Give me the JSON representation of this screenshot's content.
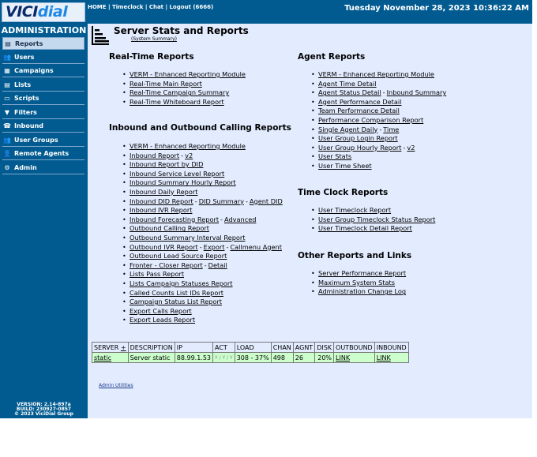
{
  "header": {
    "logo": {
      "vici": "VICI",
      "dial": "dial"
    },
    "links": [
      "HOME",
      "Timeclock",
      "Chat",
      "Logout (6666)"
    ],
    "datetime": "Tuesday November 28, 2023 10:36:22 AM"
  },
  "sidebar": {
    "title": "ADMINISTRATION",
    "items": [
      {
        "label": "Reports",
        "icon": "reports-icon",
        "glyph": "▤"
      },
      {
        "label": "Users",
        "icon": "users-icon",
        "glyph": "👥"
      },
      {
        "label": "Campaigns",
        "icon": "campaigns-icon",
        "glyph": "▦"
      },
      {
        "label": "Lists",
        "icon": "lists-icon",
        "glyph": "▤"
      },
      {
        "label": "Scripts",
        "icon": "scripts-icon",
        "glyph": "▭"
      },
      {
        "label": "Filters",
        "icon": "filters-icon",
        "glyph": "▼"
      },
      {
        "label": "Inbound",
        "icon": "inbound-icon",
        "glyph": "☎"
      },
      {
        "label": "User Groups",
        "icon": "user-groups-icon",
        "glyph": "👥"
      },
      {
        "label": "Remote Agents",
        "icon": "remote-agents-icon",
        "glyph": "👤"
      },
      {
        "label": "Admin",
        "icon": "admin-gear-icon",
        "glyph": "⚙"
      }
    ],
    "version": [
      "VERSION: 2.14-897a",
      "BUILD: 230927-0857",
      "© 2023 ViciDial Group"
    ]
  },
  "main": {
    "title": "Server Stats and Reports",
    "subtitle": "(System Summary)",
    "realtime": {
      "heading": "Real-Time Reports",
      "items": [
        [
          "VERM - Enhanced Reporting Module"
        ],
        [
          "Real-Time Main Report"
        ],
        [
          "Real-Time Campaign Summary"
        ],
        [
          "Real-Time Whiteboard Report"
        ]
      ]
    },
    "inout": {
      "heading": "Inbound and Outbound Calling Reports",
      "items": [
        [
          "VERM - Enhanced Reporting Module"
        ],
        [
          "Inbound Report",
          "v2"
        ],
        [
          "Inbound Report by DID"
        ],
        [
          "Inbound Service Level Report"
        ],
        [
          "Inbound Summary Hourly Report"
        ],
        [
          "Inbound Daily Report"
        ],
        [
          "Inbound DID Report",
          "DID Summary",
          "Agent DID"
        ],
        [
          "Inbound IVR Report"
        ],
        [
          "Inbound Forecasting Report",
          "Advanced"
        ],
        [
          "Outbound Calling Report"
        ],
        [
          "Outbound Summary Interval Report"
        ],
        [
          "Outbound IVR Report",
          "Export",
          "Callmenu Agent"
        ],
        [
          "Outbound Lead Source Report"
        ],
        [
          "Fronter - Closer Report",
          "Detail"
        ],
        [
          "Lists Pass Report"
        ],
        [
          "Lists Campaign Statuses Report"
        ],
        [
          "Called Counts List IDs Report"
        ],
        [
          "Campaign Status List Report"
        ],
        [
          "Export Calls Report"
        ],
        [
          "Export Leads Report"
        ]
      ]
    },
    "agent": {
      "heading": "Agent Reports",
      "items": [
        [
          "VERM - Enhanced Reporting Module"
        ],
        [
          "Agent Time Detail"
        ],
        [
          "Agent Status Detail",
          "Inbound Summary"
        ],
        [
          "Agent Performance Detail"
        ],
        [
          "Team Performance Detail"
        ],
        [
          "Performance Comparison Report"
        ],
        [
          "Single Agent Daily",
          "Time"
        ],
        [
          "User Group Login Report"
        ],
        [
          "User Group Hourly Report",
          "v2"
        ],
        [
          "User Stats"
        ],
        [
          "User Time Sheet"
        ]
      ]
    },
    "timeclock": {
      "heading": "Time Clock Reports",
      "items": [
        [
          "User Timeclock Report"
        ],
        [
          "User Group Timeclock Status Report"
        ],
        [
          "User Timeclock Detail Report"
        ]
      ]
    },
    "other": {
      "heading": "Other Reports and Links",
      "items": [
        [
          "Server Performance Report"
        ],
        [
          "Maximum System Stats"
        ],
        [
          "Administration Change Log"
        ]
      ]
    },
    "servers": {
      "headers": [
        "SERVER",
        "+",
        "DESCRIPTION",
        "IP",
        "ACT",
        "LOAD",
        "CHAN",
        "AGNT",
        "DISK",
        "OUTBOUND",
        "INBOUND"
      ],
      "row": {
        "server": "static",
        "description": "Server static",
        "ip": "88.99.1.53",
        "act": "Y / Y / Y",
        "load": "308 - 37%",
        "chan": "498",
        "agnt": "26",
        "disk": "20%",
        "outbound": "LINK",
        "inbound": "LINK"
      }
    },
    "admin_utilities": "Admin Utilities"
  }
}
